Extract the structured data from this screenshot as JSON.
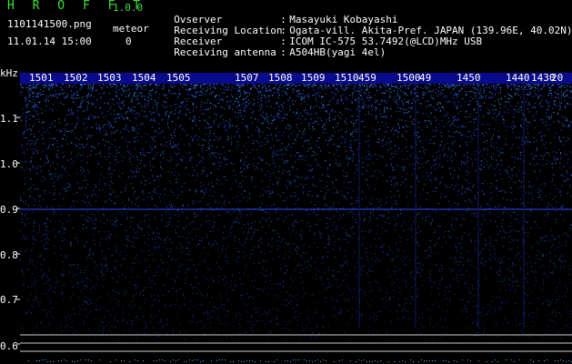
{
  "header": {
    "app_title": "H R O F F T",
    "app_version": "1.0.0",
    "file_name": "1101141500.png",
    "datetime": "11.01.14 15:00",
    "meteor_label": "meteor",
    "meteor_count": "0"
  },
  "info": [
    {
      "key": "Ovserver",
      "sep": ":",
      "value": "Masayuki Kobayashi"
    },
    {
      "key": "Receiving Location",
      "sep": ":",
      "value": "Ogata-vill. Akita-Pref. JAPAN (139.96E, 40.02N)"
    },
    {
      "key": "Receiver",
      "sep": ":",
      "value": "ICOM IC-575 53.7492(@LCD)MHz USB"
    },
    {
      "key": "Receiving antenna",
      "sep": ":",
      "value": "A504HB(yagi 4el)"
    }
  ],
  "spectrogram": {
    "unit_label": "kHz",
    "y_ticks": [
      "1.1",
      "1.0",
      "0.9",
      "0.8",
      "0.7",
      "0.6"
    ],
    "time_labels": [
      "1501",
      "1502",
      "1503",
      "1504",
      "1505",
      "1507",
      "1508",
      "1509",
      "1510",
      "459",
      "1500",
      "49",
      "1450",
      "1440",
      "1430",
      "20"
    ],
    "colors": {
      "background": "#000000",
      "signal": "#2a3cff",
      "label_bar": "#0a0a8c",
      "line": "#d0d0d0"
    }
  }
}
